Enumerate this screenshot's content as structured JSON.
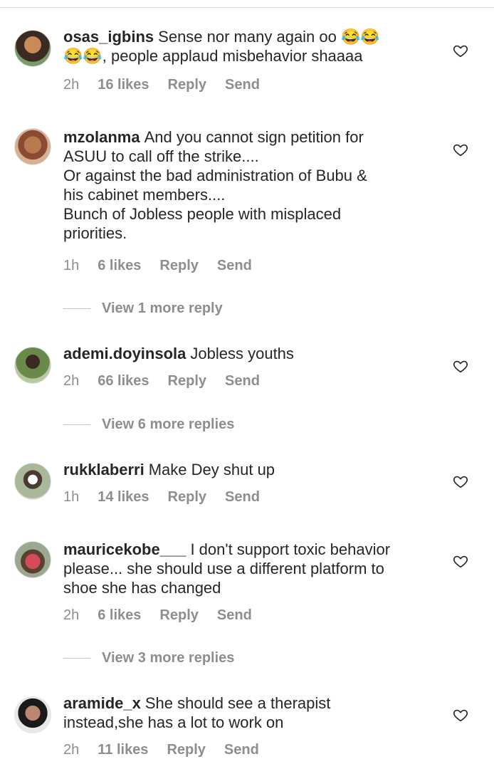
{
  "comments": [
    {
      "username": "osas_igbins",
      "lines": [
        "Sense nor many again oo 😂😂",
        "😂😂, people applaud misbehavior shaaaa"
      ],
      "time": "2h",
      "likes": "16 likes",
      "reply": "Reply",
      "send": "Send"
    },
    {
      "username": "mzolanma",
      "lines": [
        "And you cannot sign petition for",
        "ASUU to call off the strike....",
        "Or against the bad administration of Bubu &",
        "his cabinet members....",
        "Bunch of Jobless people with misplaced",
        "priorities."
      ],
      "time": "1h",
      "likes": "6 likes",
      "reply": "Reply",
      "send": "Send",
      "view_more": "View 1 more reply"
    },
    {
      "username": "ademi.doyinsola",
      "lines": [
        "Jobless youths"
      ],
      "time": "2h",
      "likes": "66 likes",
      "reply": "Reply",
      "send": "Send",
      "view_more": "View 6 more replies"
    },
    {
      "username": "rukklaberri",
      "lines": [
        "Make Dey shut up"
      ],
      "time": "1h",
      "likes": "14 likes",
      "reply": "Reply",
      "send": "Send"
    },
    {
      "username": "mauricekobe___",
      "lines": [
        "I don't support toxic behavior",
        "please... she should use a different platform to",
        "shoe she has changed"
      ],
      "time": "2h",
      "likes": "6 likes",
      "reply": "Reply",
      "send": "Send",
      "view_more": "View 3 more replies"
    },
    {
      "username": "aramide_x",
      "lines": [
        "She should see a therapist",
        "instead,she has a lot to work on"
      ],
      "time": "2h",
      "likes": "11 likes",
      "reply": "Reply",
      "send": "Send"
    }
  ],
  "icons": {
    "like": "heart-outline-icon"
  },
  "colors": {
    "text": "#262626",
    "secondary": "#8e8e8e",
    "divider": "#dbdbdb"
  }
}
